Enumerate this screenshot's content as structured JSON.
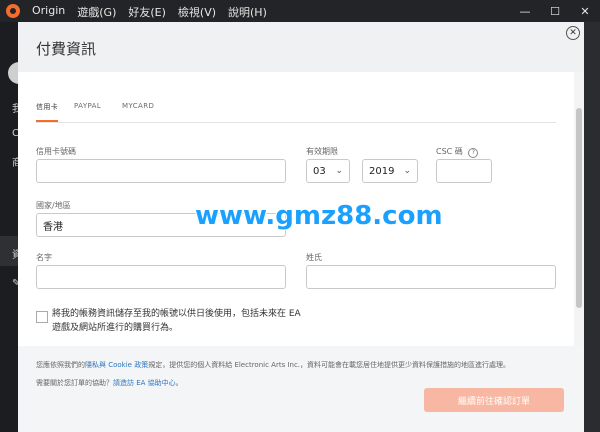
{
  "titlebar": {
    "app": "Origin",
    "menus": [
      "遊戲(G)",
      "好友(E)",
      "檢視(V)",
      "說明(H)"
    ],
    "controls": [
      "—",
      "☐",
      "✕"
    ]
  },
  "sidebar": {
    "letters": [
      "我",
      "C",
      "商",
      "資",
      "✎"
    ]
  },
  "modal": {
    "title": "付費資訊",
    "close": "✕",
    "tabs": [
      "信用卡",
      "PAYPAL",
      "MYCARD"
    ],
    "fields": {
      "card_label": "信用卡號碼",
      "expiry_label": "有效期限",
      "month": "03",
      "year": "2019",
      "csc_label": "CSC 碼",
      "country_label": "國家/地區",
      "country_value": "香港",
      "first_label": "名字",
      "last_label": "姓氏"
    },
    "save_text": "將我的帳務資訊儲存至我的帳號以供日後使用，包括未來在 EA 遊戲及網站所進行的購買行為。",
    "legal": {
      "prefix": "您應依照我們的",
      "link": "隱私與 Cookie 政策",
      "suffix": "規定，提供您的個人資料給 Electronic Arts Inc.，資料可能會在載您居住地提供更少資料保護措施的地區進行處理。"
    },
    "help": {
      "prefix": "需要關於您訂單的協助？",
      "link": "請造訪 EA 協助中心",
      "suffix": "。"
    },
    "cta": "繼續前往確認訂單"
  },
  "watermark": "www.gmz88.com"
}
